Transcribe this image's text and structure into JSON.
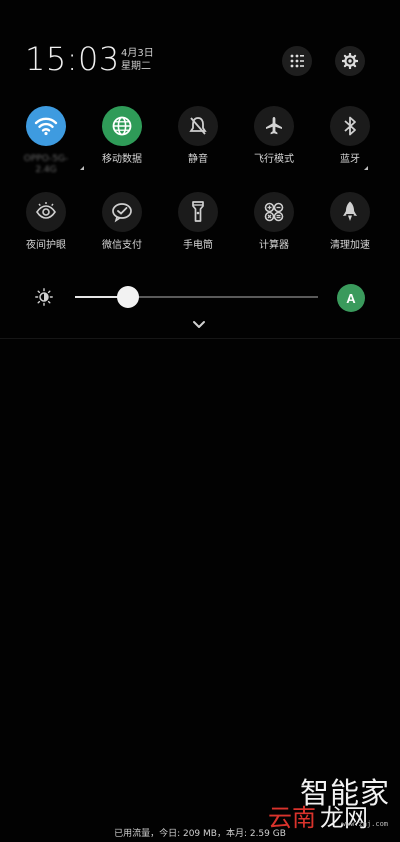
{
  "status": {
    "time": "15:03",
    "date": "4月3日",
    "weekday": "星期二"
  },
  "header_buttons": [
    {
      "icon": "grid-edit-icon"
    },
    {
      "icon": "gear-icon"
    }
  ],
  "brand_colors": {
    "wifi_on": "#3e9be0",
    "data_on": "#2f9b58",
    "auto_brightness": "#3a9a5c"
  },
  "tiles_row1": [
    {
      "label": "OPPO-5G-\n2.4G",
      "icon": "wifi-icon",
      "state": "on"
    },
    {
      "label": "移动数据",
      "icon": "globe-icon",
      "state": "on"
    },
    {
      "label": "静音",
      "icon": "mute-icon",
      "state": "off"
    },
    {
      "label": "飞行模式",
      "icon": "airplane-icon",
      "state": "off"
    },
    {
      "label": "蓝牙",
      "icon": "bluetooth-icon",
      "state": "off"
    }
  ],
  "tiles_row2": [
    {
      "label": "夜间护眼",
      "icon": "eye-care-icon",
      "state": "off"
    },
    {
      "label": "微信支付",
      "icon": "wechat-pay-icon",
      "state": "off"
    },
    {
      "label": "手电筒",
      "icon": "flashlight-icon",
      "state": "off"
    },
    {
      "label": "计算器",
      "icon": "calculator-icon",
      "state": "off"
    },
    {
      "label": "清理加速",
      "icon": "rocket-icon",
      "state": "off"
    }
  ],
  "brightness": {
    "level": 0.22,
    "auto_label": "A"
  },
  "footer": {
    "usage_text": "已用流量，今日: 209 MB，本月: 2.59 GB"
  },
  "watermark": {
    "line1": "智能家",
    "line2_red": "云南",
    "line2_white": "龙网",
    "url": "www.znj.com"
  }
}
